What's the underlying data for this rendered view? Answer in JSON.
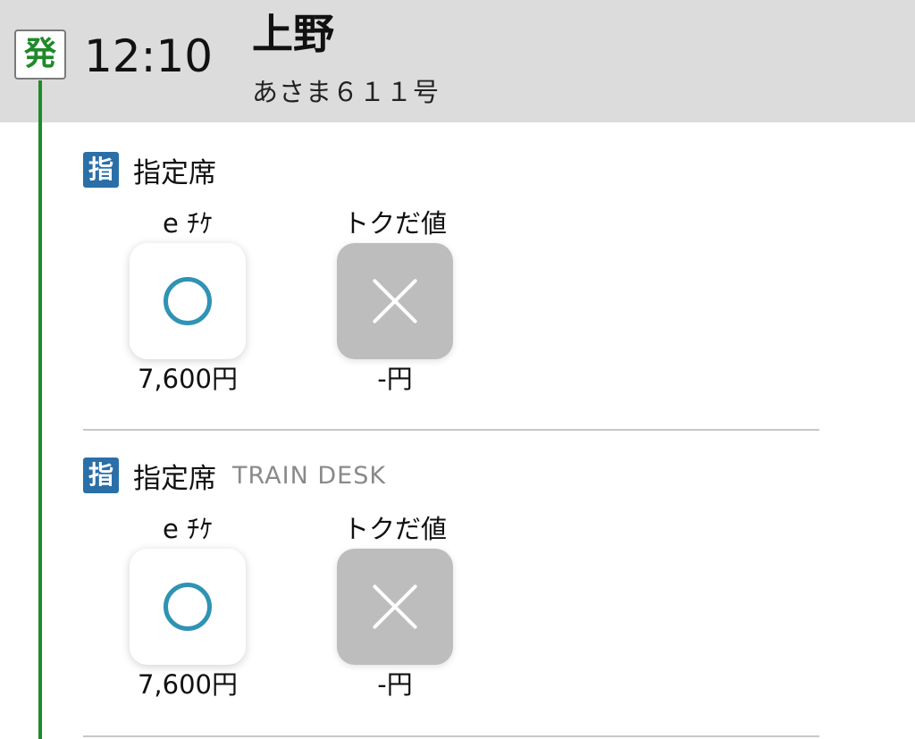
{
  "departure": {
    "badge": "発",
    "time": "12:10",
    "station": "上野",
    "train": "あさま６１１号"
  },
  "sections": [
    {
      "seat_icon": "指",
      "seat_label": "指定席",
      "seat_sub": "",
      "fares": [
        {
          "name": "e ﾁｹ",
          "available": true,
          "mark": "circle-icon",
          "price": "7,600円"
        },
        {
          "name": "トクだ値",
          "available": false,
          "mark": "x-icon",
          "price": "-円"
        }
      ]
    },
    {
      "seat_icon": "指",
      "seat_label": "指定席",
      "seat_sub": "TRAIN DESK",
      "fares": [
        {
          "name": "e ﾁｹ",
          "available": true,
          "mark": "circle-icon",
          "price": "7,600円"
        },
        {
          "name": "トクだ値",
          "available": false,
          "mark": "x-icon",
          "price": "-円"
        }
      ]
    }
  ],
  "colors": {
    "timeline": "#1f8a2a",
    "seat_icon_bg": "#2a6fa8",
    "available_mark": "#2f93b4",
    "unavailable_bg": "#bdbdbd",
    "header_bg": "#dcdcdc"
  }
}
